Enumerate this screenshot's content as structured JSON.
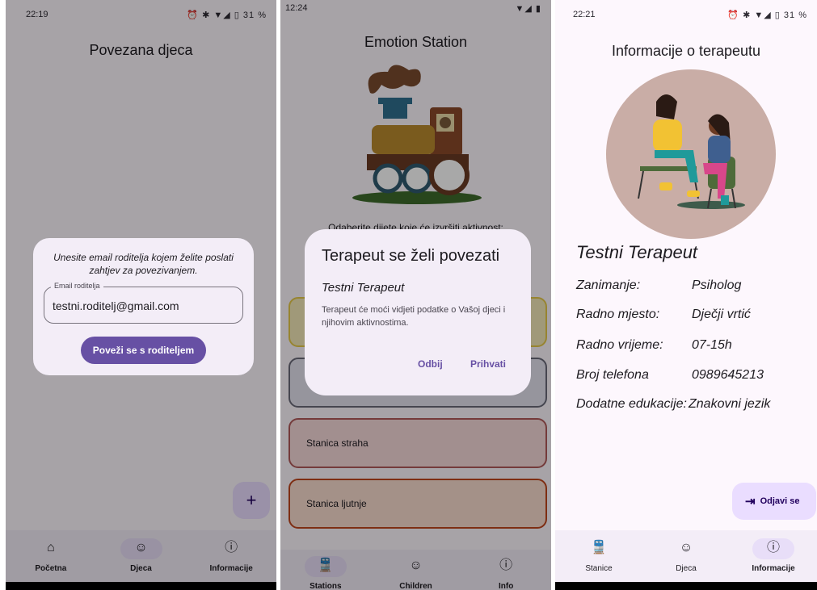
{
  "phone1": {
    "status_time": "22:19",
    "status_icons": "⏰ ✱ ▼◢ ▯ 31 %",
    "title": "Povezana djeca",
    "dialog": {
      "message": "Unesite email roditelja kojem želite poslati zahtjev za povezivanjem.",
      "field_label": "Email roditelja",
      "field_value": "testni.roditelj@gmail.com",
      "button": "Poveži se s roditeljem"
    },
    "fab_icon": "plus-icon",
    "nav": [
      {
        "label": "Početna",
        "icon": "home-icon",
        "active": false
      },
      {
        "label": "Djeca",
        "icon": "face-icon",
        "active": true
      },
      {
        "label": "Informacije",
        "icon": "info-icon",
        "active": false
      }
    ]
  },
  "phone2": {
    "status_time": "12:24",
    "title": "Emotion Station",
    "subtitle_partial": "Odaberite dijete koje će izvršiti aktivnost:",
    "stations": [
      {
        "label": "",
        "color": "#e6c94a"
      },
      {
        "label": "",
        "color": "#6b6b7a"
      },
      {
        "label": "Stanica straha",
        "color": "#b05a5a"
      },
      {
        "label": "Stanica ljutnje",
        "color": "#c0461e"
      }
    ],
    "dialog": {
      "title": "Terapeut se želi povezati",
      "name": "Testni Terapeut",
      "body": "Terapeut će moći vidjeti podatke o Vašoj djeci i njihovim aktivnostima.",
      "decline": "Odbij",
      "accept": "Prihvati"
    },
    "nav": [
      {
        "label": "Stations",
        "icon": "train-icon",
        "active": true
      },
      {
        "label": "Children",
        "icon": "face-icon",
        "active": false
      },
      {
        "label": "Info",
        "icon": "info-icon",
        "active": false
      }
    ]
  },
  "phone3": {
    "status_time": "22:21",
    "status_icons": "⏰ ✱ ▼◢ ▯ 31 %",
    "title": "Informacije o terapeutu",
    "name": "Testni Terapeut",
    "rows": [
      {
        "k": "Zanimanje:",
        "v": "Psiholog"
      },
      {
        "k": "Radno mjesto:",
        "v": "Dječji vrtić"
      },
      {
        "k": "Radno vrijeme:",
        "v": "07-15h"
      },
      {
        "k": "Broj telefona",
        "v": "0989645213"
      },
      {
        "k": "Dodatne edukacije:",
        "v": "Znakovni jezik"
      }
    ],
    "logout": "Odjavi se",
    "nav": [
      {
        "label": "Stanice",
        "icon": "train-icon",
        "active": false
      },
      {
        "label": "Djeca",
        "icon": "face-icon",
        "active": false
      },
      {
        "label": "Informacije",
        "icon": "info-icon",
        "active": true
      }
    ]
  }
}
